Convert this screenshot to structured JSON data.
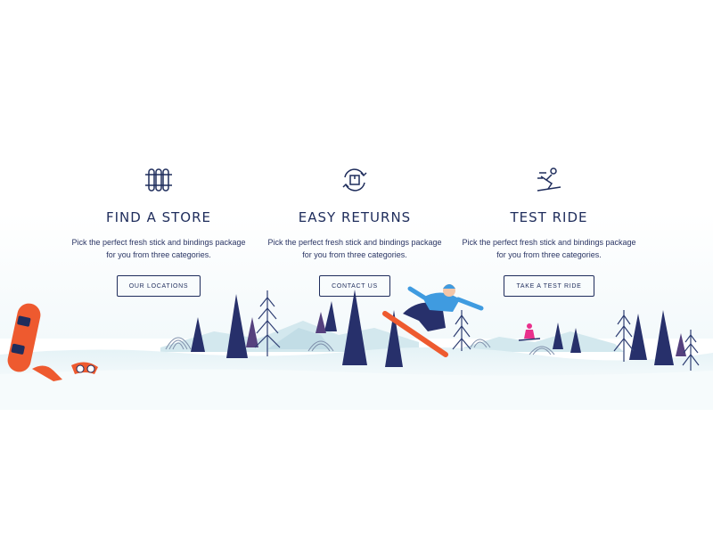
{
  "features": [
    {
      "icon": "ski-rack-icon",
      "title": "FIND A STORE",
      "description_line1": "Pick the perfect fresh stick and bindings package",
      "description_line2": "for you from three categories.",
      "button_label": "OUR LOCATIONS"
    },
    {
      "icon": "return-box-icon",
      "title": "EASY RETURNS",
      "description_line1": "Pick the perfect fresh stick and bindings package",
      "description_line2": "for you from three categories.",
      "button_label": "CONTACT US"
    },
    {
      "icon": "skier-icon",
      "title": "TEST RIDE",
      "description_line1": "Pick the perfect fresh stick and bindings package",
      "description_line2": "for you from three categories.",
      "button_label": "TAKE A TEST RIDE"
    }
  ],
  "colors": {
    "navy": "#1f2d5c",
    "accent_orange": "#ee5a2f",
    "snow": "#e6f3f7",
    "mountain": "#cfe6ec",
    "jacket_blue": "#3f9be0",
    "pink": "#e9308c"
  }
}
